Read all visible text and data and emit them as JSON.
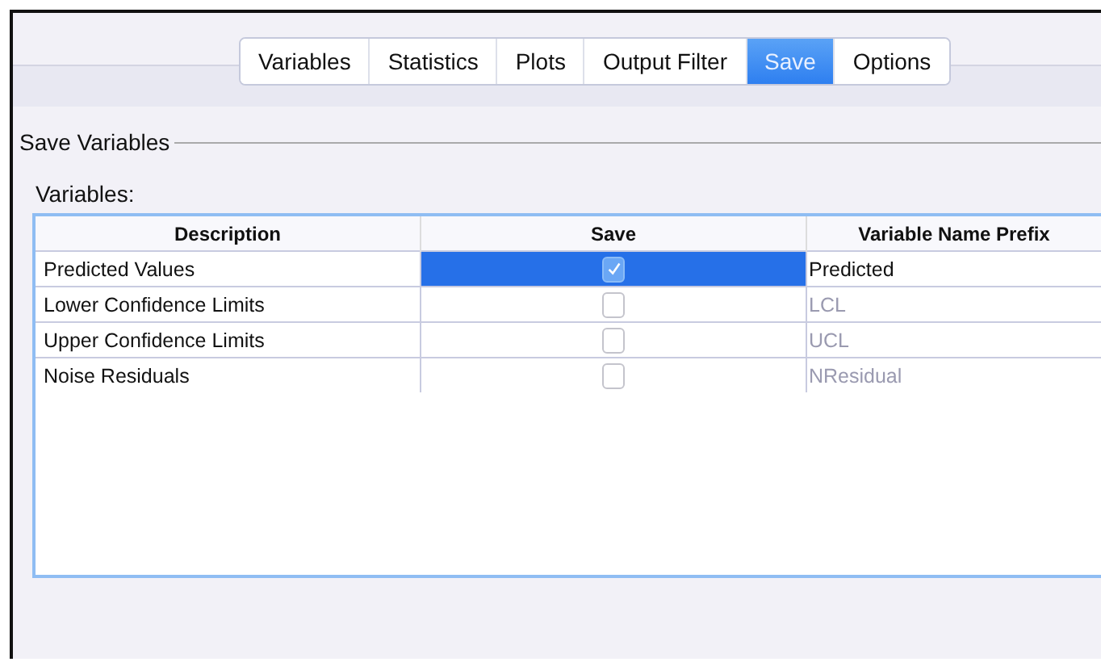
{
  "tabs": [
    {
      "label": "Variables",
      "selected": false
    },
    {
      "label": "Statistics",
      "selected": false
    },
    {
      "label": "Plots",
      "selected": false
    },
    {
      "label": "Output Filter",
      "selected": false
    },
    {
      "label": "Save",
      "selected": true
    },
    {
      "label": "Options",
      "selected": false
    }
  ],
  "group": {
    "title": "Save Variables",
    "list_label": "Variables:"
  },
  "table": {
    "columns": [
      "Description",
      "Save",
      "Variable Name Prefix"
    ],
    "rows": [
      {
        "description": "Predicted Values",
        "checked": true,
        "selected": true,
        "prefix": "Predicted"
      },
      {
        "description": "Lower Confidence Limits",
        "checked": false,
        "selected": false,
        "prefix": "LCL"
      },
      {
        "description": "Upper Confidence Limits",
        "checked": false,
        "selected": false,
        "prefix": "UCL"
      },
      {
        "description": "Noise Residuals",
        "checked": false,
        "selected": false,
        "prefix": "NResidual"
      }
    ]
  }
}
